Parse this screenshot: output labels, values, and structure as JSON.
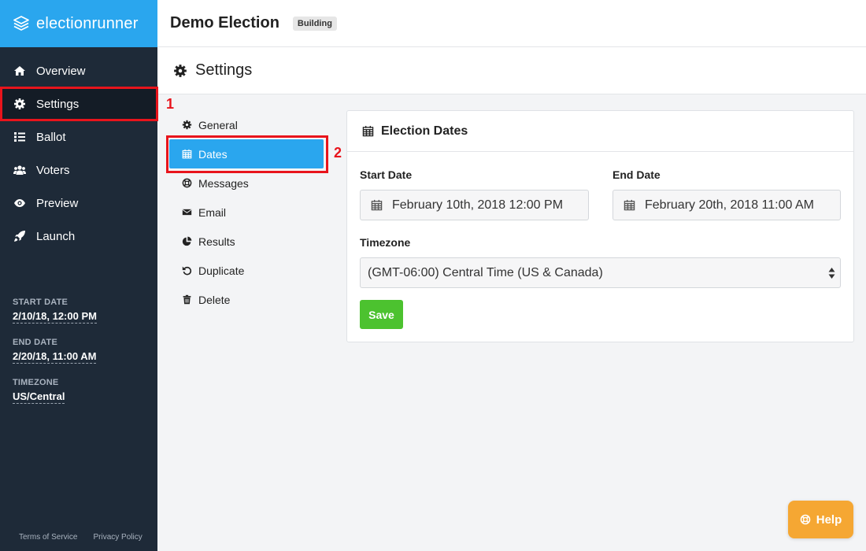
{
  "app": {
    "logo_text": "electionrunner"
  },
  "sidebar": {
    "items": [
      {
        "label": "Overview",
        "icon": "home-icon"
      },
      {
        "label": "Settings",
        "icon": "gear-icon"
      },
      {
        "label": "Ballot",
        "icon": "list-icon"
      },
      {
        "label": "Voters",
        "icon": "users-icon"
      },
      {
        "label": "Preview",
        "icon": "eye-icon"
      },
      {
        "label": "Launch",
        "icon": "rocket-icon"
      }
    ],
    "meta": {
      "start_label": "START DATE",
      "start_value": "2/10/18, 12:00 PM",
      "end_label": "END DATE",
      "end_value": "2/20/18, 11:00 AM",
      "tz_label": "TIMEZONE",
      "tz_value": "US/Central"
    },
    "footer": {
      "terms": "Terms of Service",
      "privacy": "Privacy Policy"
    }
  },
  "header": {
    "title": "Demo Election",
    "badge": "Building"
  },
  "subheader": {
    "title": "Settings"
  },
  "settings_nav": {
    "items": [
      {
        "label": "General",
        "icon": "gear-icon"
      },
      {
        "label": "Dates",
        "icon": "calendar-icon"
      },
      {
        "label": "Messages",
        "icon": "lifebuoy-icon"
      },
      {
        "label": "Email",
        "icon": "envelope-icon"
      },
      {
        "label": "Results",
        "icon": "pie-chart-icon"
      },
      {
        "label": "Duplicate",
        "icon": "undo-icon"
      },
      {
        "label": "Delete",
        "icon": "trash-icon"
      }
    ]
  },
  "card": {
    "title": "Election Dates",
    "start_label": "Start Date",
    "start_value": "February 10th, 2018 12:00 PM",
    "end_label": "End Date",
    "end_value": "February 20th, 2018 11:00 AM",
    "tz_label": "Timezone",
    "tz_value": "(GMT-06:00) Central Time (US & Canada)",
    "save_label": "Save"
  },
  "annotations": {
    "one": "1",
    "two": "2"
  },
  "help": {
    "label": "Help"
  },
  "colors": {
    "accent": "#2aa6ee",
    "sidebar": "#1e2a38",
    "save": "#4cc22f",
    "help": "#f5a733",
    "annotation": "#e8141c"
  }
}
